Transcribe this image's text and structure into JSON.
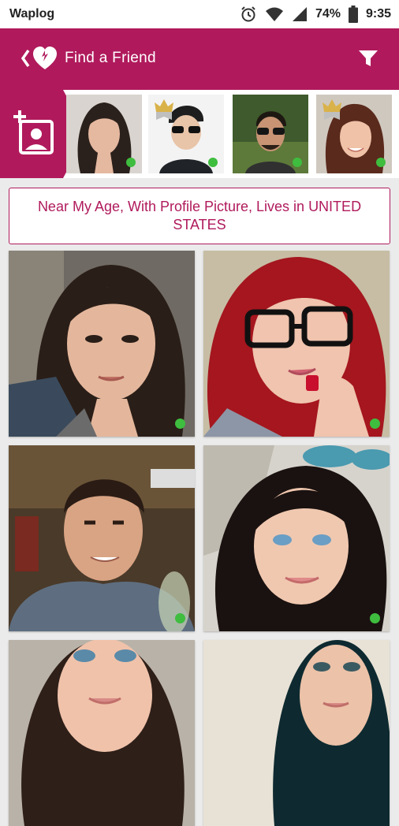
{
  "status_bar": {
    "app_name": "Waplog",
    "battery": "74%",
    "time": "9:35",
    "icons": [
      "alarm-icon",
      "wifi-icon",
      "signal-icon",
      "battery-icon"
    ]
  },
  "app_bar": {
    "title": "Find a Friend",
    "brand_color": "#b01a5c",
    "icons": [
      "back-chevron-icon",
      "waplog-heart-logo-icon",
      "filter-funnel-icon"
    ]
  },
  "featured": {
    "add_icon": "add-profile-photo-icon",
    "users": [
      {
        "name": "woman-dark-hair",
        "crown": false,
        "online": true
      },
      {
        "name": "man-sunglasses",
        "crown": true,
        "online": true
      },
      {
        "name": "man-sunglasses-outdoor",
        "crown": false,
        "online": true
      },
      {
        "name": "woman-auburn-hair",
        "crown": true,
        "online": true
      }
    ]
  },
  "filter_banner": {
    "text": "Near My Age, With Profile Picture, Lives in UNITED STATES"
  },
  "grid": [
    {
      "name": "user-card-1",
      "online": true
    },
    {
      "name": "user-card-2",
      "online": true
    },
    {
      "name": "user-card-3",
      "online": true
    },
    {
      "name": "user-card-4",
      "online": true
    },
    {
      "name": "user-card-5",
      "online": false
    },
    {
      "name": "user-card-6",
      "online": false
    }
  ],
  "colors": {
    "accent": "#b01a5c",
    "online": "#3fbd3f"
  }
}
